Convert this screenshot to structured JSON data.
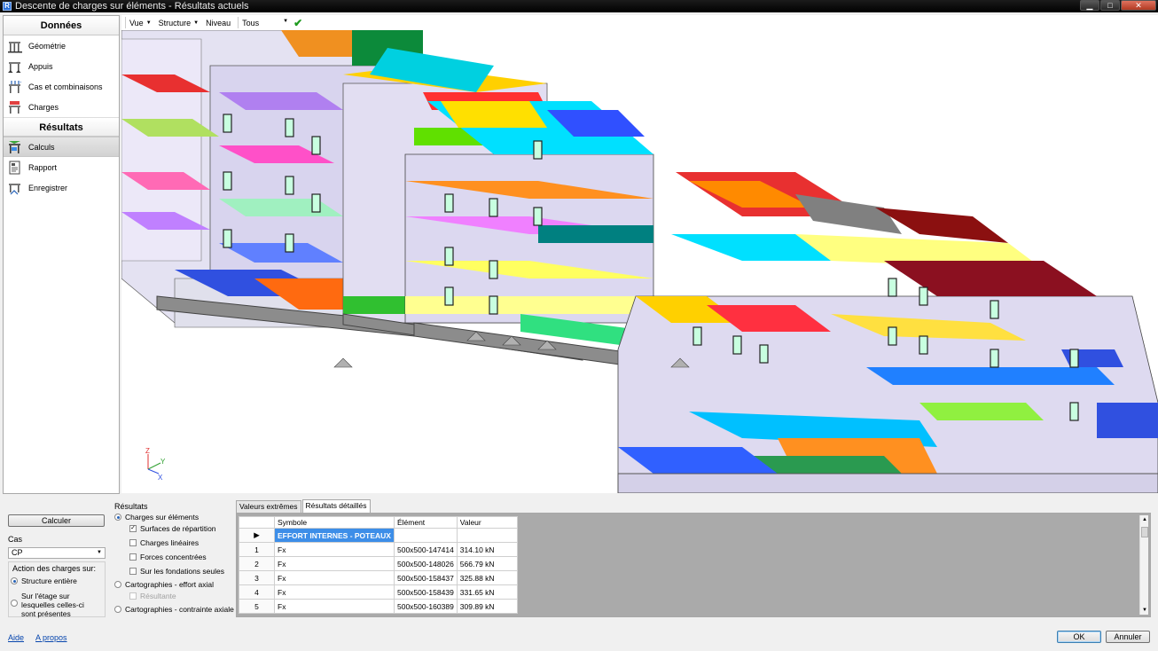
{
  "window": {
    "title": "Descente de charges sur éléments - Résultats actuels",
    "buttons": {
      "minimize": "▁",
      "maximize": "□",
      "close": "✕"
    }
  },
  "sidebar": {
    "data_section": "Données",
    "data_items": [
      {
        "label": "Géométrie",
        "icon": "frame-icon"
      },
      {
        "label": "Appuis",
        "icon": "supports-icon"
      },
      {
        "label": "Cas et combinaisons",
        "icon": "load-cases-icon"
      },
      {
        "label": "Charges",
        "icon": "loads-icon"
      }
    ],
    "results_section": "Résultats",
    "results_items": [
      {
        "label": "Calculs",
        "icon": "calculation-icon",
        "active": true
      },
      {
        "label": "Rapport",
        "icon": "report-icon"
      },
      {
        "label": "Enregistrer",
        "icon": "save-structure-icon"
      }
    ]
  },
  "toolbar": {
    "view": "Vue",
    "structure": "Structure",
    "level": "Niveau",
    "level_value": "Tous",
    "apply_icon": "checkmark-icon"
  },
  "controls": {
    "calculate": "Calculer",
    "case_label": "Cas",
    "case_value": "CP",
    "action_label": "Action des charges sur:",
    "whole_structure": "Structure entière",
    "on_floor_line1": "Sur l'étage sur",
    "on_floor_line2": "lesquelles celles-ci",
    "on_floor_line3": "sont présentes",
    "help": "Aide",
    "about": "A propos"
  },
  "results_options": {
    "title": "Résultats",
    "charges_on_elements": "Charges sur éléments",
    "distribution_surfaces": "Surfaces de répartition",
    "linear_loads": "Charges linéaires",
    "point_forces": "Forces concentrées",
    "on_foundations": "Sur les fondations seules",
    "map_axial_force": "Cartographies - effort axial",
    "resultant": "Résultante",
    "map_axial_stress": "Cartographies - contrainte axiale"
  },
  "tabs": [
    "Valeurs extrêmes",
    "Résultats détaillés"
  ],
  "grid": {
    "columns": [
      "Symbole",
      "Élément",
      "Valeur"
    ],
    "group_header": "EFFORT INTERNES - POTEAUX",
    "rows": [
      {
        "n": "1",
        "sym": "Fx",
        "el": "500x500-147414",
        "val": "314.10 kN"
      },
      {
        "n": "2",
        "sym": "Fx",
        "el": "500x500-148026",
        "val": "566.79 kN"
      },
      {
        "n": "3",
        "sym": "Fx",
        "el": "500x500-158437",
        "val": "325.88 kN"
      },
      {
        "n": "4",
        "sym": "Fx",
        "el": "500x500-158439",
        "val": "331.65 kN"
      },
      {
        "n": "5",
        "sym": "Fx",
        "el": "500x500-160389",
        "val": "309.89 kN"
      }
    ]
  },
  "dialog": {
    "ok": "OK",
    "cancel": "Annuler"
  },
  "viewport": {
    "axis_z": "Z",
    "axis_y": "Y",
    "axis_x": "X"
  }
}
